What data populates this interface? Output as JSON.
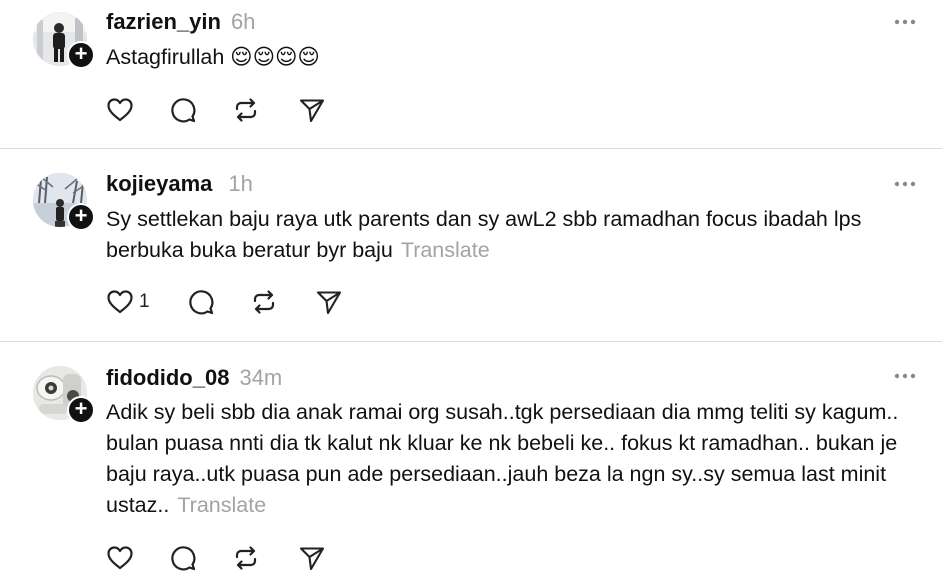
{
  "posts": [
    {
      "username": "fazrien_yin",
      "time": "6h",
      "text": "Astagfirullah 😌😌😌😌",
      "translate": "",
      "like_count": ""
    },
    {
      "username": "kojieyama",
      "time": "1h",
      "text": "Sy settlekan baju raya utk parents dan sy awL2 sbb ramadhan focus ibadah lps berbuka buka beratur byr baju",
      "translate": "Translate",
      "like_count": "1"
    },
    {
      "username": "fidodido_08",
      "time": "34m",
      "text": "Adik sy beli sbb dia anak ramai org susah..tgk persediaan dia mmg teliti sy kagum.. bulan puasa nnti dia tk kalut nk kluar ke nk bebeli ke.. fokus kt ramadhan.. bukan je baju raya..utk puasa pun ade persediaan..jauh beza la ngn sy..sy semua last minit ustaz..",
      "translate": "Translate",
      "like_count": ""
    }
  ],
  "icons": {
    "follow": "plus-icon",
    "more": "more-horizontal-icon",
    "like": "heart-icon",
    "reply": "comment-icon",
    "repost": "repost-icon",
    "share": "send-icon"
  }
}
